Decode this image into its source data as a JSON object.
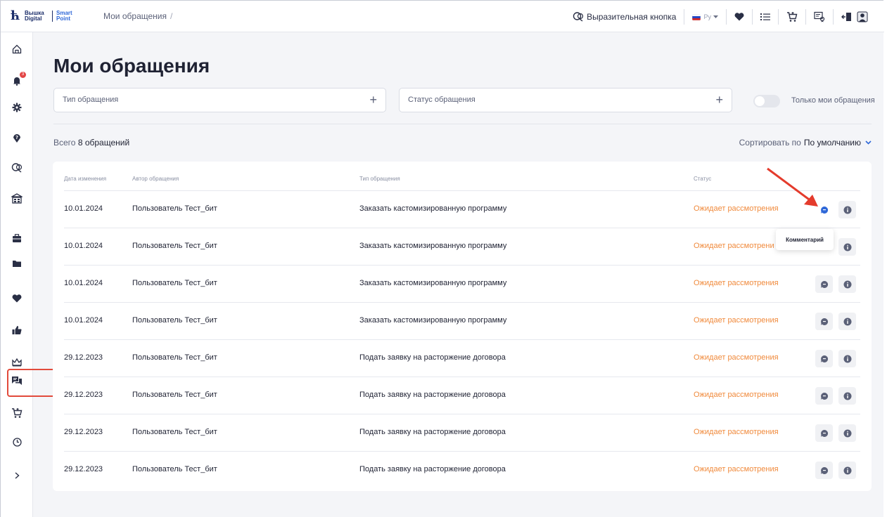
{
  "app": {
    "logo_primary": "Вышка Digital",
    "logo_secondary": "Smart Point",
    "breadcrumb": "Мои обращения",
    "breadcrumb_sep": "/"
  },
  "topbar": {
    "expressive_button": "Выразительная кнопка",
    "language": "Ру",
    "icons": [
      "favorites-icon",
      "list-icon",
      "cart-icon",
      "certificate-icon",
      "logout-icon",
      "user-icon"
    ]
  },
  "sidebar": {
    "items": [
      {
        "name": "home-icon"
      },
      {
        "name": "notifications-icon",
        "badge": "3"
      },
      {
        "name": "settings-icon"
      },
      {
        "name": "help-icon"
      },
      {
        "name": "chat-icon"
      },
      {
        "name": "institution-icon"
      },
      {
        "name": "briefcase-icon"
      },
      {
        "name": "folder-icon"
      },
      {
        "name": "heart-icon"
      },
      {
        "name": "like-icon"
      },
      {
        "name": "crown-icon"
      },
      {
        "name": "requests-icon",
        "active": true
      },
      {
        "name": "cart-icon"
      },
      {
        "name": "clock-icon"
      },
      {
        "name": "expand-icon"
      }
    ]
  },
  "main": {
    "title": "Мои обращения",
    "filter_type_placeholder": "Тип обращения",
    "filter_status_placeholder": "Статус обращения",
    "only_mine_label": "Только мои обращения",
    "total_prefix": "Всего",
    "total_value": "8 обращений",
    "sort_label": "Сортировать по",
    "sort_value": "По умолчанию"
  },
  "table": {
    "headers": {
      "date": "Дата изменения",
      "author": "Автор обращения",
      "type": "Тип обращения",
      "status": "Статус"
    },
    "rows": [
      {
        "date": "10.01.2024",
        "author": "Пользователь Тест_бит",
        "type": "Заказать кастомизированную программу",
        "status": "Ожидает рассмотрения"
      },
      {
        "date": "10.01.2024",
        "author": "Пользователь Тест_бит",
        "type": "Заказать кастомизированную программу",
        "status": "Ожидает рассмотрени"
      },
      {
        "date": "10.01.2024",
        "author": "Пользователь Тест_бит",
        "type": "Заказать кастомизированную программу",
        "status": "Ожидает рассмотрения"
      },
      {
        "date": "10.01.2024",
        "author": "Пользователь Тест_бит",
        "type": "Заказать кастомизированную программу",
        "status": "Ожидает рассмотрения"
      },
      {
        "date": "29.12.2023",
        "author": "Пользователь Тест_бит",
        "type": "Подать заявку на расторжение договора",
        "status": "Ожидает рассмотрения"
      },
      {
        "date": "29.12.2023",
        "author": "Пользователь Тест_бит",
        "type": "Подать заявку на расторжение договора",
        "status": "Ожидает рассмотрения"
      },
      {
        "date": "29.12.2023",
        "author": "Пользователь Тест_бит",
        "type": "Подать заявку на расторжение договора",
        "status": "Ожидает рассмотрения"
      },
      {
        "date": "29.12.2023",
        "author": "Пользователь Тест_бит",
        "type": "Подать заявку на расторжение договора",
        "status": "Ожидает рассмотрения"
      }
    ],
    "tooltip": "Комментарий"
  },
  "colors": {
    "accent": "#2f68d8",
    "status": "#f08a3c",
    "highlight": "#e24a3b"
  }
}
